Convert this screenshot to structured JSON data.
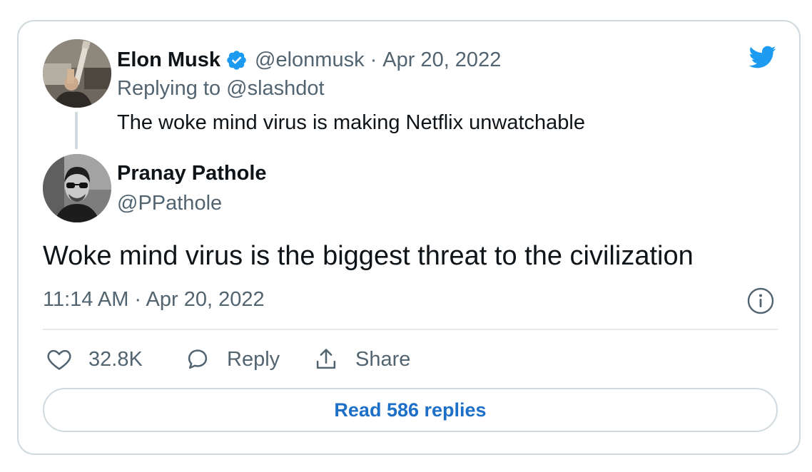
{
  "original_tweet": {
    "name": "Elon Musk",
    "handle": "@elonmusk",
    "date": "Apr 20, 2022",
    "separator": "·",
    "replying_to": "Replying to @slashdot",
    "text": "The woke mind virus is making Netflix unwatchable"
  },
  "main_tweet": {
    "name": "Pranay Pathole",
    "handle": "@PPathole",
    "text": "Woke mind virus is the biggest threat to the civilization",
    "timestamp": "11:14 AM · Apr 20, 2022"
  },
  "actions": {
    "like_count": "32.8K",
    "reply_label": "Reply",
    "share_label": "Share"
  },
  "read_replies_label": "Read 586 replies",
  "icons": {
    "brand": "twitter-bird-icon",
    "verified": "verified-badge-icon",
    "info": "info-icon",
    "like": "heart-icon",
    "reply": "reply-bubble-icon",
    "share": "share-icon"
  },
  "colors": {
    "brand_blue": "#1d9bf0",
    "link_blue": "#1d6fc8",
    "text_primary": "#0f1419",
    "text_secondary": "#536471",
    "border": "#cfd9de"
  }
}
